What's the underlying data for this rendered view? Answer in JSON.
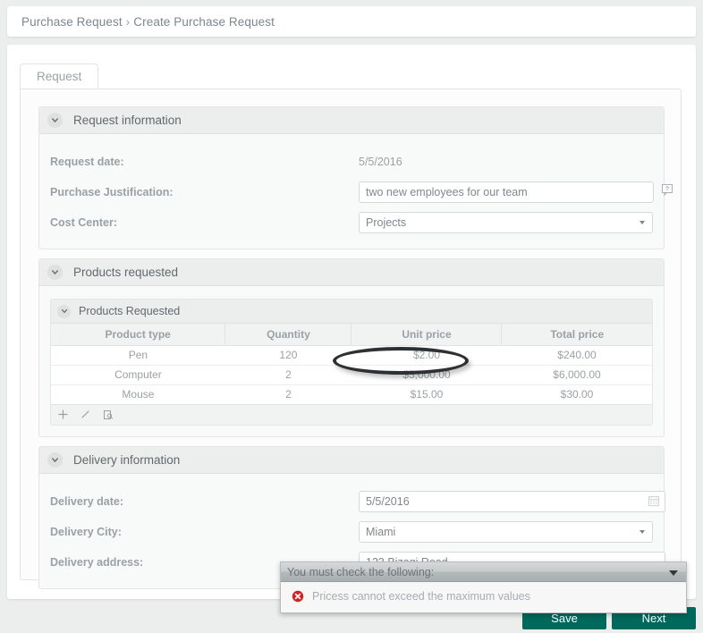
{
  "breadcrumb": {
    "root": "Purchase Request",
    "separator": "›",
    "current": "Create Purchase Request"
  },
  "tabs": [
    {
      "label": "Request",
      "active": true
    }
  ],
  "sections": {
    "request_information": {
      "title": "Request information",
      "fields": {
        "request_date": {
          "label": "Request date:",
          "value": "5/5/2016"
        },
        "purchase_justification": {
          "label": "Purchase Justification:",
          "value": "two new employees for our team",
          "placeholder": "",
          "help_icon": "comment-help-icon"
        },
        "cost_center": {
          "label": "Cost Center:",
          "value": "Projects",
          "options": [
            "Projects"
          ]
        }
      }
    },
    "products_requested": {
      "title": "Products requested",
      "inner_title": "Products Requested",
      "columns": [
        "Product type",
        "Quantity",
        "Unit price",
        "Total price"
      ],
      "rows": [
        {
          "product_type": "Pen",
          "quantity": "120",
          "unit_price": "$2.00",
          "total_price": "$240.00"
        },
        {
          "product_type": "Computer",
          "quantity": "2",
          "unit_price": "$3,000.00",
          "total_price": "$6,000.00"
        },
        {
          "product_type": "Mouse",
          "quantity": "2",
          "unit_price": "$15.00",
          "total_price": "$30.00"
        }
      ],
      "toolbar": [
        {
          "name": "add-row-icon",
          "glyph": "+"
        },
        {
          "name": "edit-row-icon",
          "glyph": "╱"
        },
        {
          "name": "duplicate-row-icon",
          "glyph": "❐"
        }
      ],
      "annotation": {
        "shape": "ellipse",
        "target_cell": "$3,000.00",
        "color": "#2e3134"
      }
    },
    "delivery_information": {
      "title": "Delivery information",
      "fields": {
        "delivery_date": {
          "label": "Delivery date:",
          "value": "5/5/2016",
          "icon": "calendar-icon"
        },
        "delivery_city": {
          "label": "Delivery City:",
          "value": "Miami",
          "options": [
            "Miami"
          ]
        },
        "delivery_address": {
          "label": "Delivery address:",
          "value": "123 Bizagi Road",
          "placeholder": ""
        }
      }
    }
  },
  "validation_popup": {
    "title": "You must check the following:",
    "caret_icon": "triangle-down-icon",
    "messages": [
      {
        "icon": "error-x-icon",
        "text": "Pricess cannot exceed the maximum values"
      }
    ]
  },
  "footer": {
    "save_label": "Save",
    "next_label": "Next"
  },
  "colors": {
    "button_teal": "#00695c",
    "page_background": "#eceeed",
    "panel_background": "#fcfcfc",
    "section_header": "#eceeed",
    "error_red": "#d32020",
    "annotation_black": "#2e3134",
    "text_muted": "#9aa1a5"
  }
}
